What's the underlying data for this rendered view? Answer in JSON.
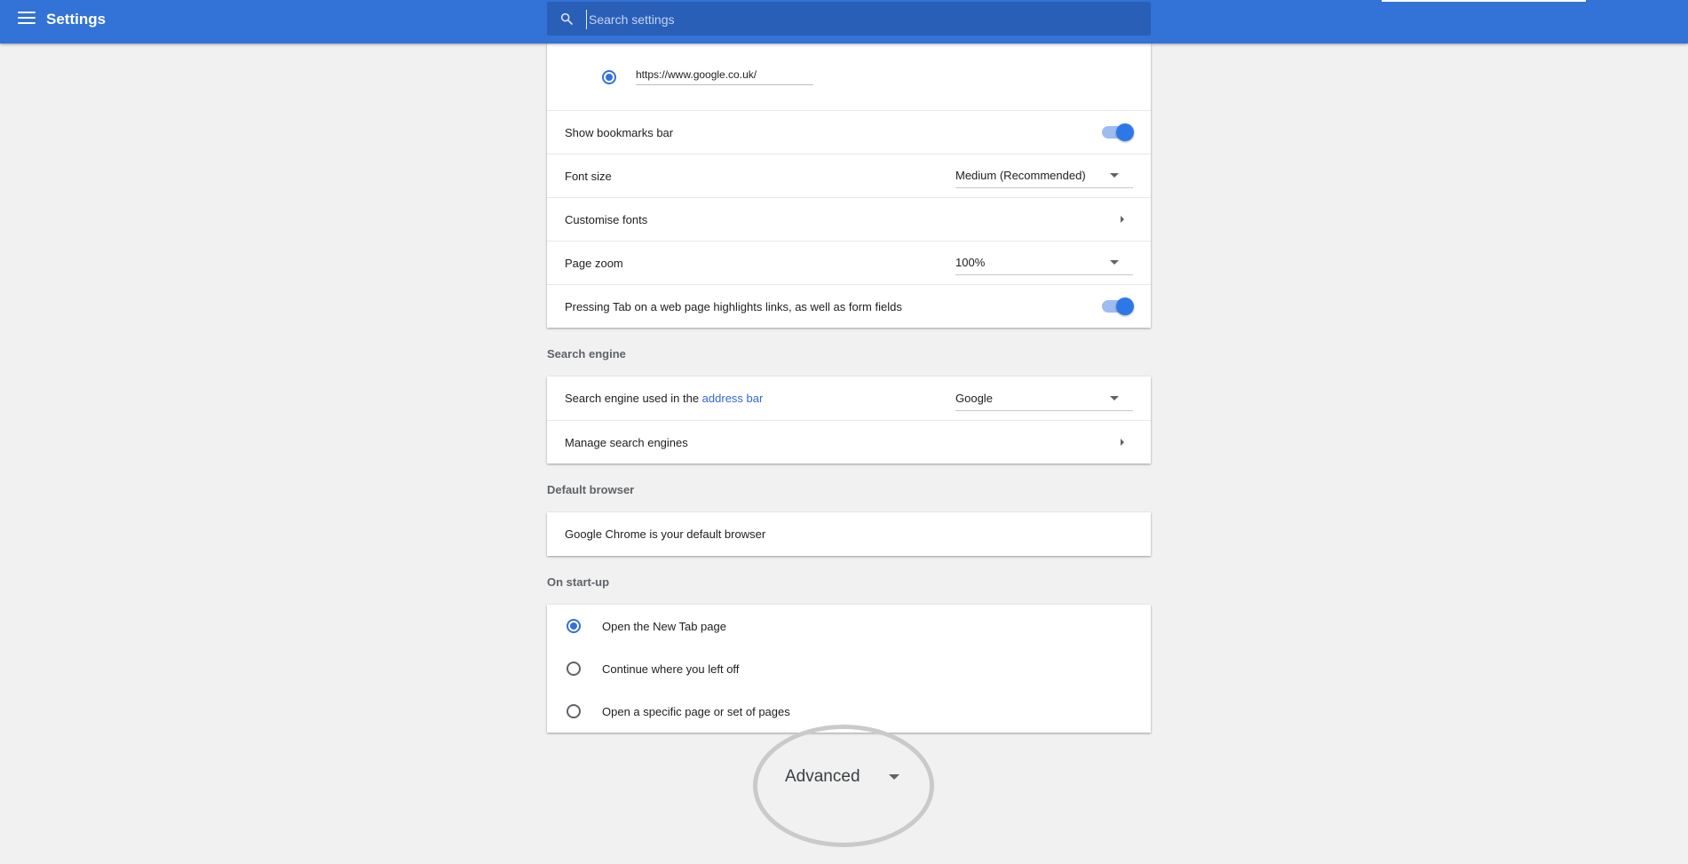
{
  "header": {
    "title": "Settings",
    "search_placeholder": "Search settings"
  },
  "appearance": {
    "homepage_url": "https://www.google.co.uk/",
    "show_bookmarks_bar": {
      "label": "Show bookmarks bar",
      "on": true
    },
    "font_size": {
      "label": "Font size",
      "value": "Medium (Recommended)"
    },
    "customise_fonts": {
      "label": "Customise fonts"
    },
    "page_zoom": {
      "label": "Page zoom",
      "value": "100%"
    },
    "tab_highlights": {
      "label": "Pressing Tab on a web page highlights links, as well as form fields",
      "on": true
    }
  },
  "search_engine": {
    "section_title": "Search engine",
    "used_in_prefix": "Search engine used in the ",
    "used_in_link": "address bar",
    "value": "Google",
    "manage_label": "Manage search engines"
  },
  "default_browser": {
    "section_title": "Default browser",
    "status": "Google Chrome is your default browser"
  },
  "startup": {
    "section_title": "On start-up",
    "options": [
      {
        "label": "Open the New Tab page",
        "checked": true
      },
      {
        "label": "Continue where you left off",
        "checked": false
      },
      {
        "label": "Open a specific page or set of pages",
        "checked": false
      }
    ]
  },
  "advanced": {
    "label": "Advanced"
  },
  "colors": {
    "header_blue": "#3372d6",
    "accent": "#2d78e8",
    "link": "#3367d6"
  }
}
